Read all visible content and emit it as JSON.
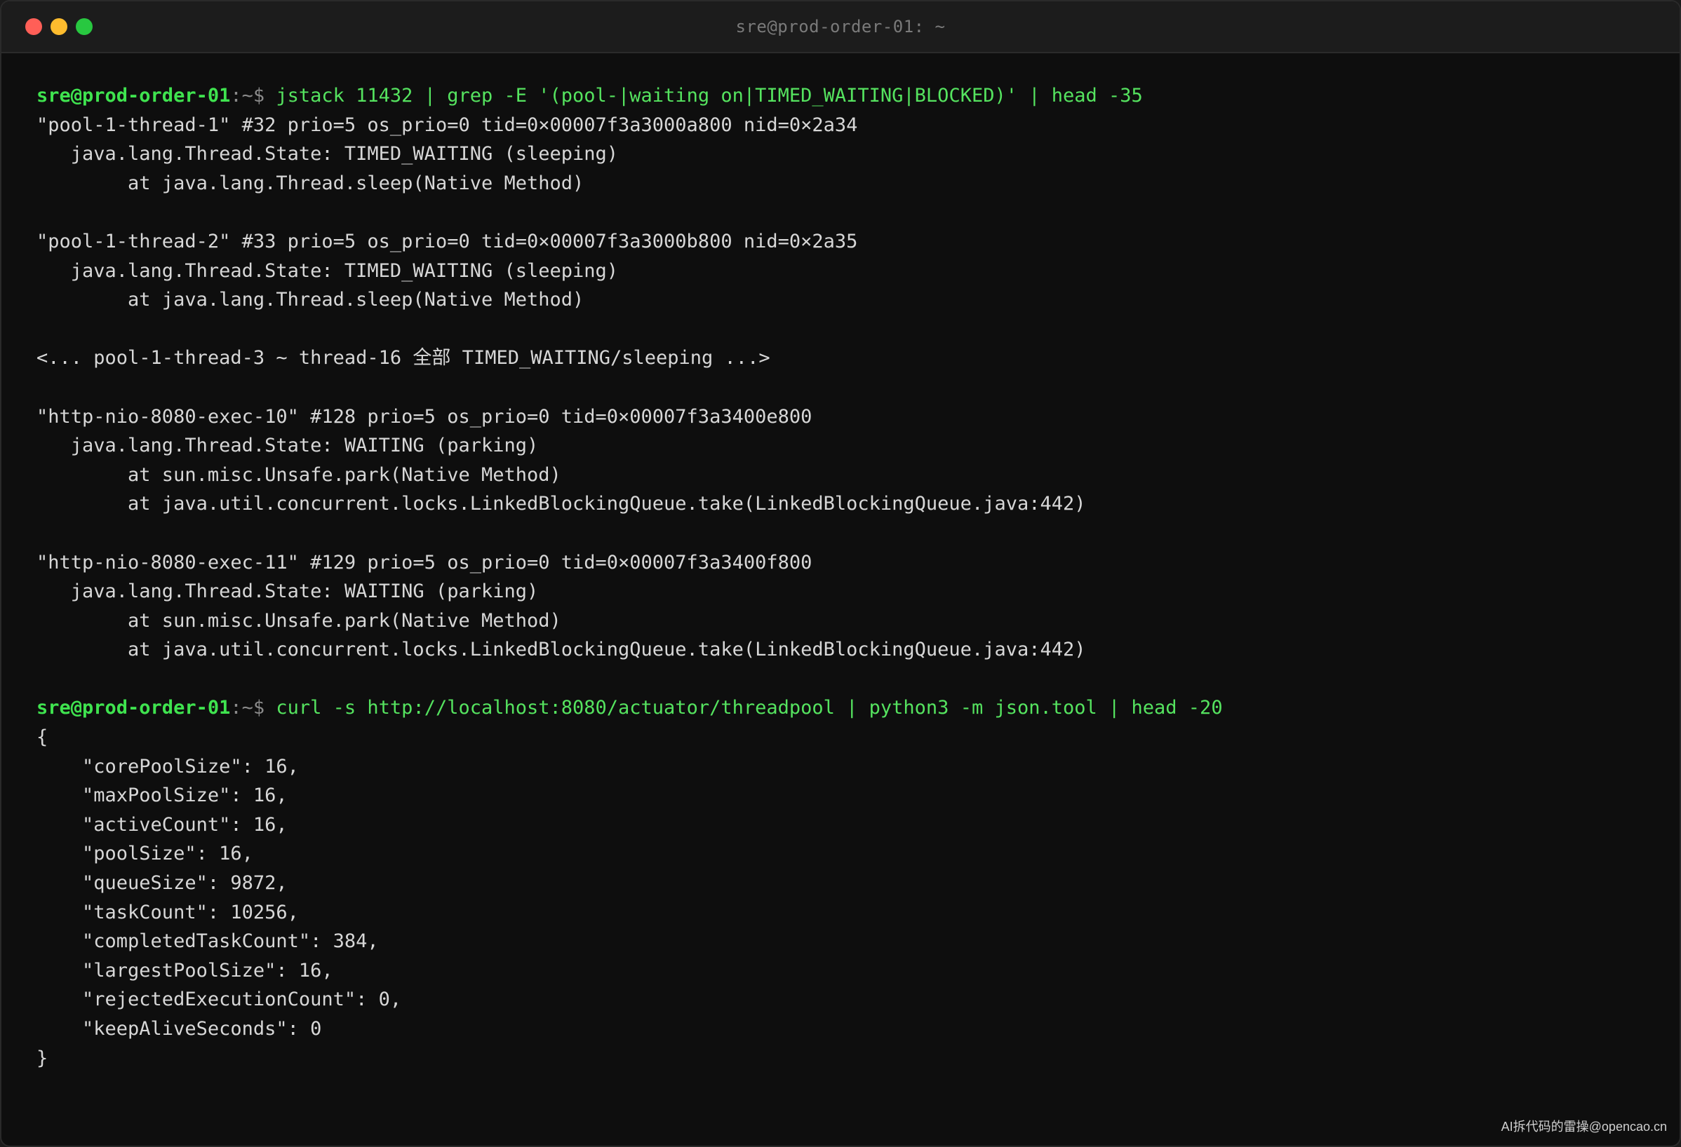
{
  "window": {
    "title": "sre@prod-order-01: ~"
  },
  "terminal": {
    "lines": [
      {
        "kind": "prompt",
        "user": "sre@prod-order-01",
        "sep": ":~$ ",
        "cmd": "jstack 11432 | grep -E '(pool-|waiting on|TIMED_WAITING|BLOCKED)' | head -35"
      },
      {
        "kind": "text",
        "text": "\"pool-1-thread-1\" #32 prio=5 os_prio=0 tid=0×00007f3a3000a800 nid=0×2a34"
      },
      {
        "kind": "text",
        "text": "   java.lang.Thread.State: TIMED_WAITING (sleeping)"
      },
      {
        "kind": "text",
        "text": "        at java.lang.Thread.sleep(Native Method)"
      },
      {
        "kind": "blank",
        "text": ""
      },
      {
        "kind": "text",
        "text": "\"pool-1-thread-2\" #33 prio=5 os_prio=0 tid=0×00007f3a3000b800 nid=0×2a35"
      },
      {
        "kind": "text",
        "text": "   java.lang.Thread.State: TIMED_WAITING (sleeping)"
      },
      {
        "kind": "text",
        "text": "        at java.lang.Thread.sleep(Native Method)"
      },
      {
        "kind": "blank",
        "text": ""
      },
      {
        "kind": "text",
        "text": "<... pool-1-thread-3 ~ thread-16 全部 TIMED_WAITING/sleeping ...>"
      },
      {
        "kind": "blank",
        "text": ""
      },
      {
        "kind": "text",
        "text": "\"http-nio-8080-exec-10\" #128 prio=5 os_prio=0 tid=0×00007f3a3400e800"
      },
      {
        "kind": "text",
        "text": "   java.lang.Thread.State: WAITING (parking)"
      },
      {
        "kind": "text",
        "text": "        at sun.misc.Unsafe.park(Native Method)"
      },
      {
        "kind": "text",
        "text": "        at java.util.concurrent.locks.LinkedBlockingQueue.take(LinkedBlockingQueue.java:442)"
      },
      {
        "kind": "blank",
        "text": ""
      },
      {
        "kind": "text",
        "text": "\"http-nio-8080-exec-11\" #129 prio=5 os_prio=0 tid=0×00007f3a3400f800"
      },
      {
        "kind": "text",
        "text": "   java.lang.Thread.State: WAITING (parking)"
      },
      {
        "kind": "text",
        "text": "        at sun.misc.Unsafe.park(Native Method)"
      },
      {
        "kind": "text",
        "text": "        at java.util.concurrent.locks.LinkedBlockingQueue.take(LinkedBlockingQueue.java:442)"
      },
      {
        "kind": "blank",
        "text": ""
      },
      {
        "kind": "prompt",
        "user": "sre@prod-order-01",
        "sep": ":~$ ",
        "cmd": "curl -s http://localhost:8080/actuator/threadpool | python3 -m json.tool | head -20"
      },
      {
        "kind": "text",
        "text": "{"
      },
      {
        "kind": "text",
        "text": "    \"corePoolSize\": 16,"
      },
      {
        "kind": "text",
        "text": "    \"maxPoolSize\": 16,"
      },
      {
        "kind": "text",
        "text": "    \"activeCount\": 16,"
      },
      {
        "kind": "text",
        "text": "    \"poolSize\": 16,"
      },
      {
        "kind": "text",
        "text": "    \"queueSize\": 9872,"
      },
      {
        "kind": "text",
        "text": "    \"taskCount\": 10256,"
      },
      {
        "kind": "text",
        "text": "    \"completedTaskCount\": 384,"
      },
      {
        "kind": "text",
        "text": "    \"largestPoolSize\": 16,"
      },
      {
        "kind": "text",
        "text": "    \"rejectedExecutionCount\": 0,"
      },
      {
        "kind": "text",
        "text": "    \"keepAliveSeconds\": 0"
      },
      {
        "kind": "text",
        "text": "}"
      }
    ]
  },
  "watermark": {
    "text": "AI拆代码的雷操@opencao.cn"
  },
  "colors": {
    "prompt_user": "#3fe34f",
    "command": "#55e35f",
    "output_text": "#d7d7d7",
    "background": "#0e0e0e"
  }
}
